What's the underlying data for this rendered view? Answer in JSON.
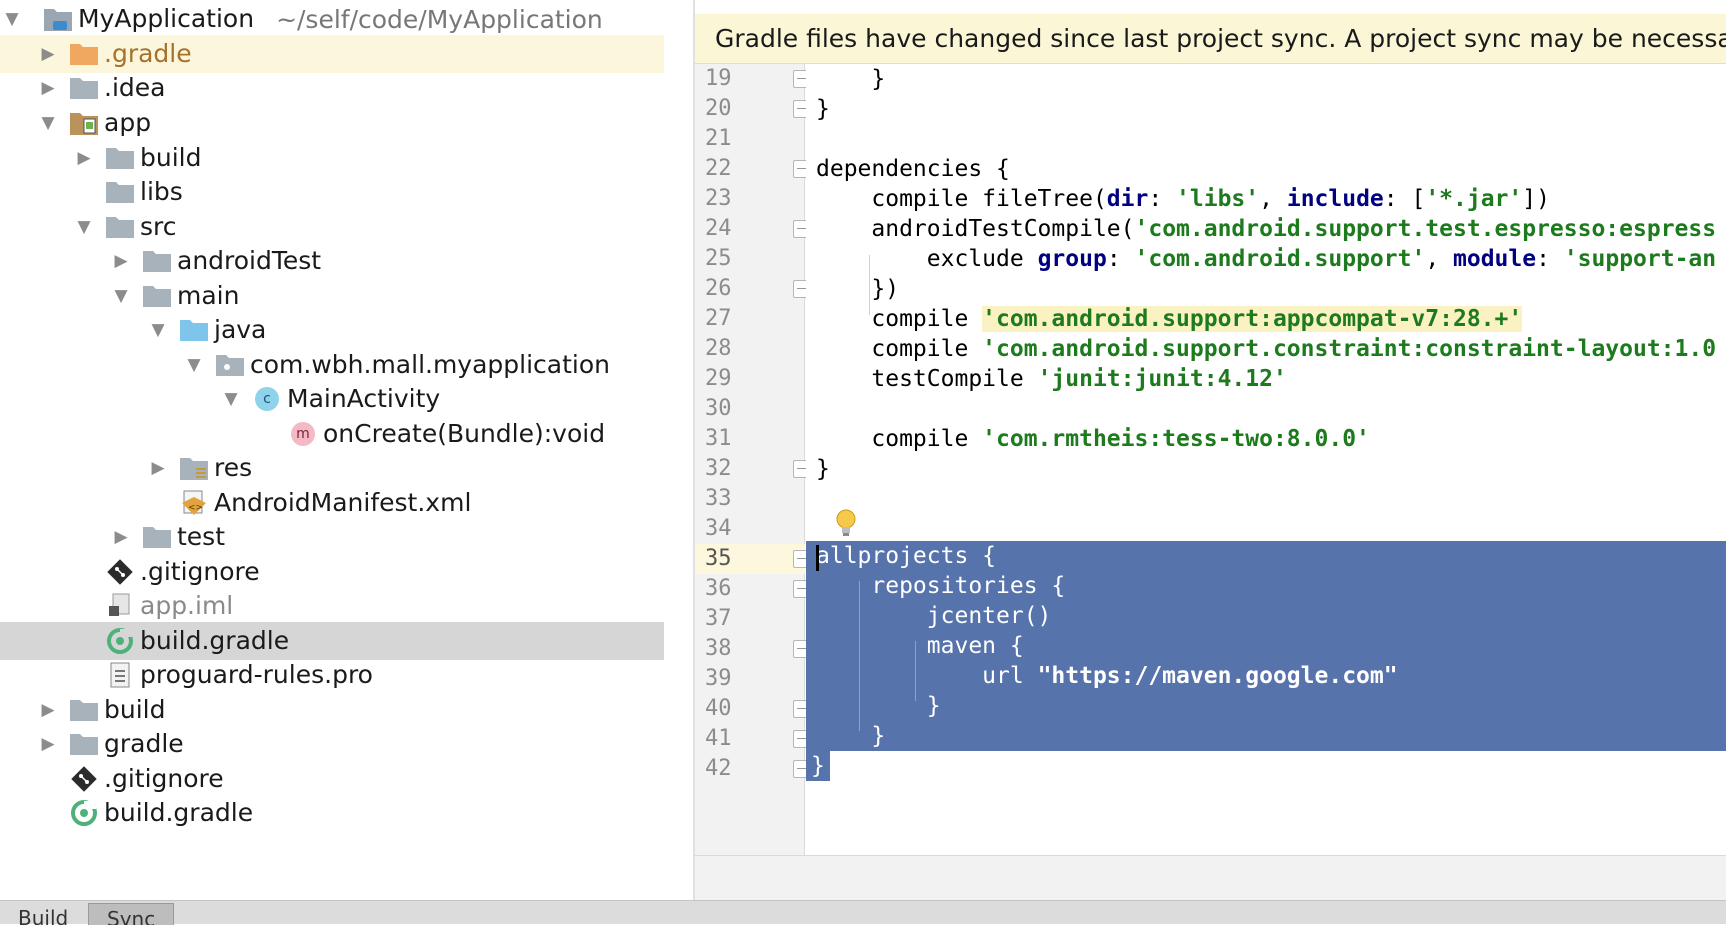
{
  "project_tree": {
    "root": {
      "label": "MyApplication",
      "path": "~/self/code/MyApplication"
    },
    "items": [
      {
        "label": ".gradle"
      },
      {
        "label": ".idea"
      },
      {
        "label": "app"
      },
      {
        "label": "build"
      },
      {
        "label": "libs"
      },
      {
        "label": "src"
      },
      {
        "label": "androidTest"
      },
      {
        "label": "main"
      },
      {
        "label": "java"
      },
      {
        "label": "com.wbh.mall.myapplication"
      },
      {
        "label": "MainActivity",
        "badge": "c"
      },
      {
        "label": "onCreate(Bundle):void",
        "badge": "m"
      },
      {
        "label": "res"
      },
      {
        "label": "AndroidManifest.xml"
      },
      {
        "label": "test"
      },
      {
        "label": ".gitignore"
      },
      {
        "label": "app.iml"
      },
      {
        "label": "build.gradle"
      },
      {
        "label": "proguard-rules.pro"
      },
      {
        "label": "build"
      },
      {
        "label": "gradle"
      },
      {
        "label": ".gitignore"
      },
      {
        "label": "build.gradle"
      }
    ]
  },
  "editor": {
    "banner": "Gradle files have changed since last project sync. A project sync may be necessary",
    "line_numbers": [
      "19",
      "20",
      "21",
      "22",
      "23",
      "24",
      "25",
      "26",
      "27",
      "28",
      "29",
      "30",
      "31",
      "32",
      "33",
      "34",
      "35",
      "36",
      "37",
      "38",
      "39",
      "40",
      "41",
      "42"
    ],
    "code": {
      "l19": "    }",
      "l20": "}",
      "l22": "dependencies {",
      "l23": {
        "a": "    compile fileTree(",
        "k1": "dir",
        "b": ": ",
        "s1": "'libs'",
        "c": ", ",
        "k2": "include",
        "d": ": [",
        "s2": "'*.jar'",
        "e": "])"
      },
      "l24": {
        "a": "    androidTestCompile(",
        "s1": "'com.android.support.test.espresso:espress"
      },
      "l25": {
        "a": "        exclude ",
        "k1": "group",
        "b": ": ",
        "s1": "'com.android.support'",
        "c": ", ",
        "k2": "module",
        "d": ": ",
        "s2": "'support-an"
      },
      "l26": "    })",
      "l27": {
        "a": "    compile ",
        "s1": "'com.android.support:appcompat-v7:28.+'"
      },
      "l28": {
        "a": "    compile ",
        "s1": "'com.android.support.constraint:constraint-layout:1.0"
      },
      "l29": {
        "a": "    testCompile ",
        "s1": "'junit:junit:4.12'"
      },
      "l31": {
        "a": "    compile ",
        "s1": "'com.rmtheis:tess-two:8.0.0'"
      },
      "l32": "}",
      "l35": "allprojects {",
      "l36": "    repositories {",
      "l37": "        jcenter()",
      "l38": "        maven {",
      "l39": {
        "a": "            url ",
        "s1": "\"https://maven.google.com\""
      },
      "l40": "        }",
      "l41": "    }",
      "l42": "}"
    }
  },
  "bottom_tabs": [
    "Build",
    "Sync"
  ],
  "colors": {
    "selection": "#5773ab",
    "banner": "#fbf6d5",
    "string": "#1d7b1d",
    "keyword": "#000080"
  },
  "icons": {
    "root": "module-folder-icon",
    "gradle_folder": "orange-folder-icon",
    "folder": "folder-icon",
    "git": "git-icon",
    "gradle": "gradle-icon",
    "bulb": "lightbulb-icon"
  }
}
